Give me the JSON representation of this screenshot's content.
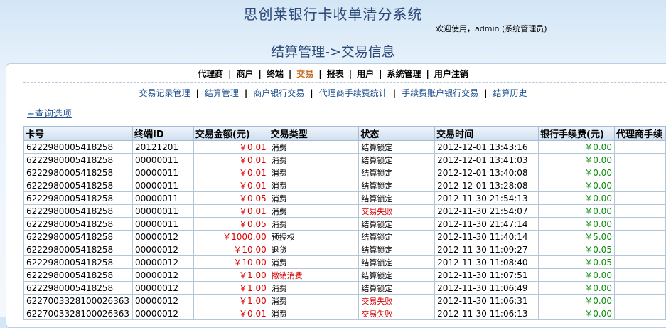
{
  "header": {
    "system_title": "思创莱银行卡收单清分系统",
    "welcome": "欢迎使用，admin (系统管理员)",
    "page_title": "结算管理->交易信息"
  },
  "nav": {
    "items": [
      {
        "label": "代理商",
        "active": false
      },
      {
        "label": "商户",
        "active": false
      },
      {
        "label": "终端",
        "active": false
      },
      {
        "label": "交易",
        "active": true
      },
      {
        "label": "报表",
        "active": false
      },
      {
        "label": "用户",
        "active": false
      },
      {
        "label": "系统管理",
        "active": false
      },
      {
        "label": "用户注销",
        "active": false
      }
    ],
    "separator": "|"
  },
  "subnav": {
    "items": [
      "交易记录管理",
      "结算管理",
      "商户银行交易",
      "代理商手续费统计",
      "手续费账户银行交易",
      "结算历史"
    ],
    "separator": "|"
  },
  "query_toggle": "+查询选项",
  "table": {
    "columns": [
      "卡号",
      "终端ID",
      "交易金额(元)",
      "交易类型",
      "状态",
      "交易时间",
      "银行手续费(元)",
      "代理商手续"
    ],
    "rows": [
      [
        "6222980005418258",
        "20121201",
        "￥0.01",
        "消费",
        "结算锁定",
        "2012-12-01 13:43:16",
        "￥0.00",
        ""
      ],
      [
        "6222980005418258",
        "00000011",
        "￥0.01",
        "消费",
        "结算锁定",
        "2012-12-01 13:41:03",
        "￥0.00",
        ""
      ],
      [
        "6222980005418258",
        "00000011",
        "￥0.01",
        "消费",
        "结算锁定",
        "2012-12-01 13:40:08",
        "￥0.00",
        ""
      ],
      [
        "6222980005418258",
        "00000011",
        "￥0.01",
        "消费",
        "结算锁定",
        "2012-12-01 13:28:08",
        "￥0.00",
        ""
      ],
      [
        "6222980005418258",
        "00000011",
        "￥0.05",
        "消费",
        "结算锁定",
        "2012-11-30 21:54:13",
        "￥0.00",
        ""
      ],
      [
        "6222980005418258",
        "00000011",
        "￥0.01",
        "消费",
        "交易失败",
        "2012-11-30 21:54:07",
        "￥0.00",
        ""
      ],
      [
        "6222980005418258",
        "00000011",
        "￥0.05",
        "消费",
        "结算锁定",
        "2012-11-30 21:47:14",
        "￥0.00",
        ""
      ],
      [
        "6222980005418258",
        "00000012",
        "￥1000.00",
        "预授权",
        "结算锁定",
        "2012-11-30 11:40:14",
        "￥5.00",
        ""
      ],
      [
        "6222980005418258",
        "00000012",
        "￥10.00",
        "退货",
        "结算锁定",
        "2012-11-30 11:09:27",
        "￥0.05",
        ""
      ],
      [
        "6222980005418258",
        "00000012",
        "￥10.00",
        "消费",
        "结算锁定",
        "2012-11-30 11:08:40",
        "￥0.05",
        ""
      ],
      [
        "6222980005418258",
        "00000012",
        "￥1.00",
        "撤销消费",
        "结算锁定",
        "2012-11-30 11:07:51",
        "￥0.00",
        ""
      ],
      [
        "6222980005418258",
        "00000012",
        "￥1.00",
        "消费",
        "结算锁定",
        "2012-11-30 11:06:49",
        "￥0.00",
        ""
      ],
      [
        "6227003328100026363",
        "00000012",
        "￥1.00",
        "消费",
        "交易失败",
        "2012-11-30 11:06:31",
        "￥0.00",
        ""
      ],
      [
        "6227003328100026363",
        "00000012",
        "￥0.01",
        "消费",
        "交易失败",
        "2012-11-30 11:06:13",
        "￥0.00",
        ""
      ]
    ]
  },
  "colors": {
    "amount": "#e00000",
    "fee": "#0a8c0a",
    "failed_status": "#d40000",
    "active_nav": "#c56a1d",
    "title": "#2c4a78",
    "link": "#1d4f8f"
  }
}
